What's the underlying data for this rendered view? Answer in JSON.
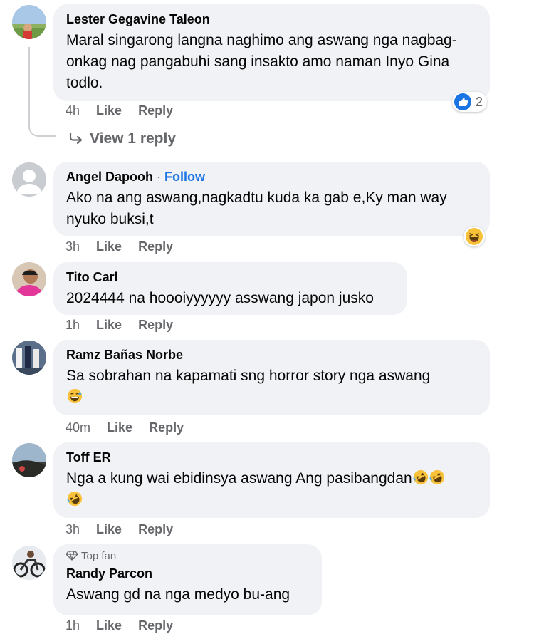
{
  "comments": [
    {
      "author": "Lester Gegavine Taleon",
      "text": "Maral singarong langna naghimo ang aswang nga nagbag-onkag nag pangabuhi sang insakto amo naman Inyo Gina todlo.",
      "time": "4h",
      "like": "Like",
      "reply": "Reply",
      "reactions": {
        "icon": "like-reaction-icon",
        "count": "2"
      },
      "view_replies": "View 1 reply"
    },
    {
      "author": "Angel Dapooh",
      "follow": "Follow",
      "text": "Ako na ang aswang,nagkadtu kuda ka gab e,Ky man way nyuko buksi,t",
      "time": "3h",
      "like": "Like",
      "reply": "Reply",
      "reactions": {
        "icon": "haha-reaction-icon"
      }
    },
    {
      "author": "Tito Carl",
      "text": "2024444 na hoooiyyyyyy asswang japon jusko",
      "time": "1h",
      "like": "Like",
      "reply": "Reply"
    },
    {
      "author": "Ramz Bañas Norbe",
      "text": "Sa sobrahan na kapamati sng horror story nga aswang",
      "time": "40m",
      "like": "Like",
      "reply": "Reply"
    },
    {
      "author": "Toff ER",
      "text": "Nga a kung wai ebidinsya aswang Ang pasibangdan",
      "time": "3h",
      "like": "Like",
      "reply": "Reply"
    },
    {
      "author": "Randy Parcon",
      "badge": "Top fan",
      "text": "Aswang gd na nga medyo bu-ang",
      "time": "1h",
      "like": "Like",
      "reply": "Reply"
    }
  ],
  "colors": {
    "bubble": "#f0f2f5",
    "meta_text": "#65676b",
    "follow": "#1b74e4",
    "like_reaction": "#1b74e4"
  }
}
